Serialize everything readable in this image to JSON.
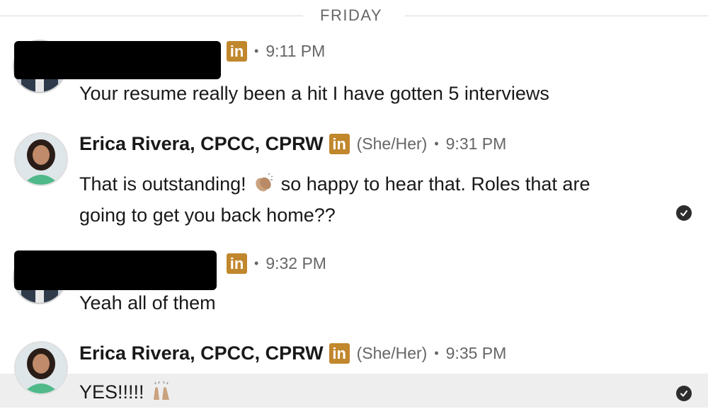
{
  "divider": {
    "label": "FRIDAY"
  },
  "messages": [
    {
      "sender": "",
      "time": "9:11 PM",
      "dot": "•",
      "linkedin_badge": "in",
      "text": "Your resume really been a hit I have gotten 5 interviews",
      "redacted": true
    },
    {
      "sender": "Erica Rivera, CPCC, CPRW",
      "pronouns": "(She/Her)",
      "time": "9:31 PM",
      "dot": "•",
      "linkedin_badge": "in",
      "text_line1_a": "That is outstanding!",
      "emoji1": "clapping-hands-emoji",
      "text_line1_b": "so happy to hear that. Roles that are",
      "text_line2": "going to get you back home??",
      "read_receipt": true
    },
    {
      "sender": "",
      "time": "9:32 PM",
      "dot": "•",
      "linkedin_badge": "in",
      "text": "Yeah all of them",
      "redacted": true
    },
    {
      "sender": "Erica Rivera, CPCC, CPRW",
      "pronouns": "(She/Her)",
      "time": "9:35 PM",
      "dot": "•",
      "linkedin_badge": "in",
      "text": "YES!!!!!",
      "emoji": "raising-hands-emoji",
      "read_receipt": true,
      "highlighted": true
    }
  ],
  "colors": {
    "linkedin_badge": "#c1872d",
    "meta_text": "#666666",
    "highlight_row": "#eeeeee",
    "check_circle": "#2d2d2d"
  }
}
